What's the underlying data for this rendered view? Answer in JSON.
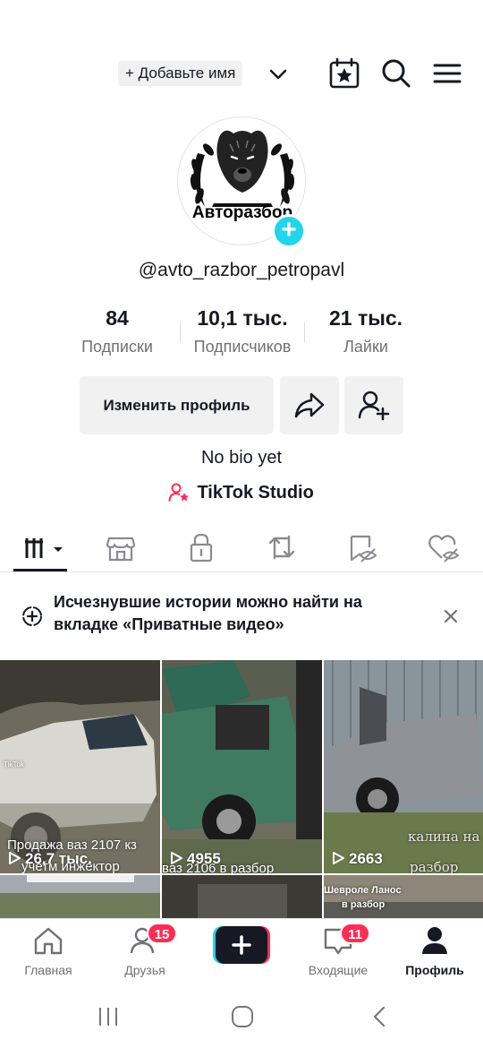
{
  "header": {
    "add_name_label": "+ Добавьте имя",
    "icons": [
      "chevron-down-icon",
      "calendar-star-icon",
      "search-icon",
      "menu-icon"
    ]
  },
  "profile": {
    "avatar_text": "Авторазбор",
    "username": "@avto_razbor_petropavl",
    "stats": [
      {
        "value": "84",
        "label": "Подписки"
      },
      {
        "value": "10,1 тыс.",
        "label": "Подписчиков"
      },
      {
        "value": "21 тыс.",
        "label": "Лайки"
      }
    ],
    "edit_profile_label": "Изменить профиль",
    "bio": "No bio yet",
    "studio_label": "TikTok Studio"
  },
  "tabs": [
    "videos-grid-icon",
    "shop-icon",
    "lock-icon",
    "repost-icon",
    "saved-hidden-icon",
    "liked-hidden-icon"
  ],
  "notice": {
    "text": "Исчезнувшие истории можно найти на вкладке «Приватные видео»"
  },
  "videos": [
    {
      "views": "26,7 тыс.",
      "overlay_line1": "Продажа ваз 2107 кз",
      "overlay_line2": "учетм инжектор",
      "watermark": "TikTok"
    },
    {
      "views": "4955",
      "overlay_line1": "ваз 2106 в разбор"
    },
    {
      "views": "2663",
      "overlay_line1": "калина на",
      "overlay_line2": "разбор"
    }
  ],
  "videos_row2": [
    {
      "overlay": ""
    },
    {
      "overlay": ""
    },
    {
      "overlay_line1": "Шевроле Ланос",
      "overlay_line2": "в разбор"
    }
  ],
  "bottom_nav": [
    {
      "label": "Главная",
      "icon": "home-icon"
    },
    {
      "label": "Друзья",
      "icon": "friends-icon",
      "badge": "15"
    },
    {
      "label": "",
      "icon": "plus-icon"
    },
    {
      "label": "Входящие",
      "icon": "inbox-icon",
      "badge": "11"
    },
    {
      "label": "Профиль",
      "icon": "profile-icon",
      "active": true
    }
  ],
  "colors": {
    "accent": "#fe2c55",
    "cyan": "#20d5ec",
    "text": "#161823",
    "muted": "#6f7076"
  }
}
